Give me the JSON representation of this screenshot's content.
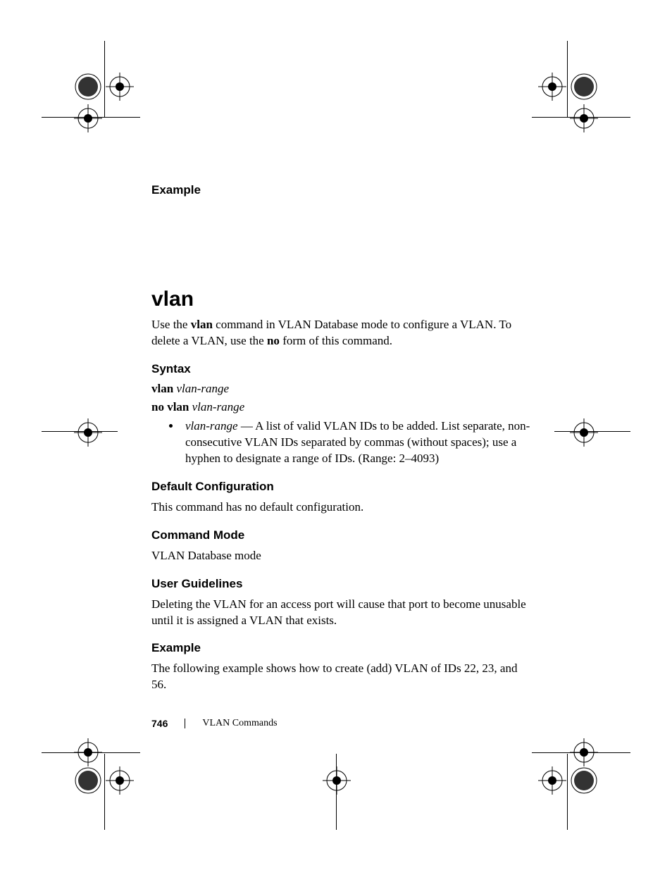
{
  "sections": {
    "example1_heading": "Example",
    "cmd_title": "vlan",
    "intro_pre": "Use the ",
    "intro_cmd": "vlan",
    "intro_mid": " command in VLAN Database mode to configure a VLAN. To delete a VLAN, use the ",
    "intro_no": "no",
    "intro_post": " form of this command.",
    "syntax_heading": "Syntax",
    "syntax1_cmd": "vlan",
    "syntax1_arg": "vlan-range",
    "syntax2_cmd": "no vlan",
    "syntax2_arg": "vlan-range",
    "bullet_term": "vlan-range",
    "bullet_body": " — A list of valid VLAN IDs to be added. List separate, non-consecutive VLAN IDs separated by commas (without spaces); use a hyphen to designate a range of IDs. (Range: 2–4093)",
    "default_heading": "Default Configuration",
    "default_body": "This command has no default configuration.",
    "mode_heading": "Command Mode",
    "mode_body": "VLAN Database mode",
    "guidelines_heading": "User Guidelines",
    "guidelines_body": "Deleting the VLAN for an access port will cause that port to become unusable until it is assigned a VLAN that exists.",
    "example2_heading": "Example",
    "example2_body": "The following example shows how to create (add) VLAN of IDs 22, 23, and 56."
  },
  "footer": {
    "page": "746",
    "section": "VLAN Commands"
  }
}
